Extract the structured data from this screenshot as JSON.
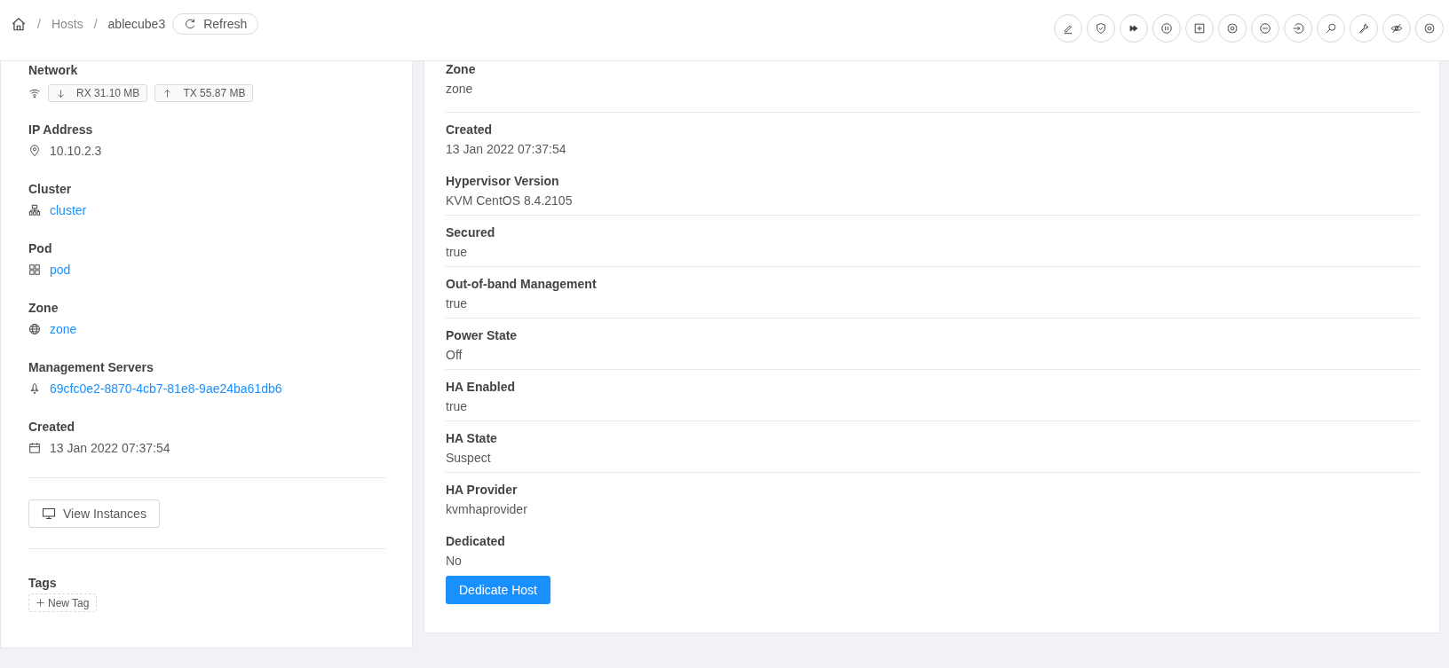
{
  "breadcrumb": {
    "separator": "/",
    "items": [
      {
        "kind": "home"
      },
      {
        "kind": "link",
        "label": "Hosts"
      },
      {
        "kind": "current",
        "label": "ablecube3"
      }
    ],
    "refresh_button": "Refresh"
  },
  "actions": [
    {
      "kind": "edit"
    },
    {
      "kind": "shield"
    },
    {
      "kind": "forward"
    },
    {
      "kind": "pause"
    },
    {
      "kind": "plus-square"
    },
    {
      "kind": "gear"
    },
    {
      "kind": "minus"
    },
    {
      "kind": "login"
    },
    {
      "kind": "search"
    },
    {
      "kind": "wrench"
    },
    {
      "kind": "eye-off"
    },
    {
      "kind": "gear"
    }
  ],
  "left_panel": {
    "network": {
      "label": "Network",
      "rx": "RX 31.10 MB",
      "tx": "TX 55.87 MB"
    },
    "fields": [
      {
        "label": "IP Address",
        "kind": "text",
        "value": "10.10.2.3"
      },
      {
        "label": "Cluster",
        "kind": "link",
        "value": "cluster"
      },
      {
        "label": "Pod",
        "kind": "link",
        "value": "pod"
      },
      {
        "label": "Zone",
        "kind": "link",
        "value": "zone"
      },
      {
        "label": "Management Servers",
        "kind": "link",
        "value": "69cfc0e2-8870-4cb7-81e8-9ae24ba61db6"
      },
      {
        "label": "Created",
        "kind": "text",
        "value": "13 Jan 2022 07:37:54"
      }
    ],
    "view_instances_button": "View Instances",
    "tags": {
      "label": "Tags",
      "new_tag_button": "New Tag"
    }
  },
  "details": [
    {
      "label": "Zone",
      "value": "zone",
      "divider_after": true
    },
    {
      "label": "Created",
      "value": "13 Jan 2022 07:37:54",
      "divider_after": false
    },
    {
      "label": "Hypervisor Version",
      "value": "KVM CentOS 8.4.2105",
      "divider_after": true
    },
    {
      "label": "Secured",
      "value": "true",
      "divider_after": true
    },
    {
      "label": "Out-of-band Management",
      "value": "true",
      "divider_after": true
    },
    {
      "label": "Power State",
      "value": "Off",
      "divider_after": true
    },
    {
      "label": "HA Enabled",
      "value": "true",
      "divider_after": true
    },
    {
      "label": "HA State",
      "value": "Suspect",
      "divider_after": true
    },
    {
      "label": "HA Provider",
      "value": "kvmhaprovider",
      "divider_after": false
    },
    {
      "label": "Dedicated",
      "value": "No",
      "divider_after": false
    }
  ],
  "dedicate_button": "Dedicate Host"
}
